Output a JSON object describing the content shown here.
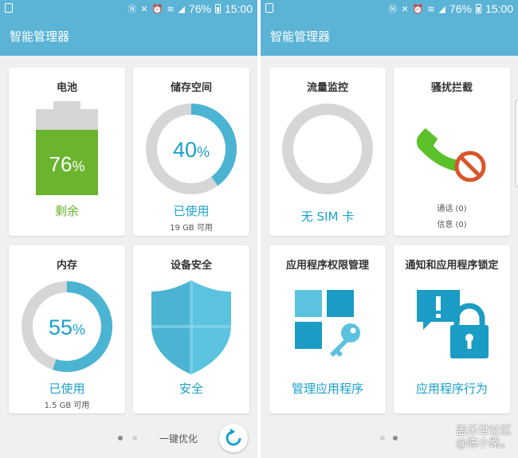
{
  "status": {
    "battery_percent": "76%",
    "time": "15:00",
    "icons": [
      "nfc-icon",
      "mute-icon",
      "alarm-icon",
      "wifi-icon",
      "signal-icon",
      "battery-icon"
    ]
  },
  "left": {
    "title": "智能管理器",
    "battery": {
      "title": "电池",
      "value": "76",
      "unit": "%",
      "label": "剩余",
      "level": 0.76
    },
    "storage": {
      "title": "储存空间",
      "value": "40",
      "unit": "%",
      "label": "已使用",
      "detail": "19 GB 可用",
      "fraction": 0.4
    },
    "memory": {
      "title": "内存",
      "value": "55",
      "unit": "%",
      "label": "已使用",
      "detail": "1.5 GB 可用",
      "fraction": 0.55
    },
    "security": {
      "title": "设备安全",
      "label": "安全"
    },
    "bottom": {
      "optimize_label": "一键优化",
      "page_index": 0,
      "page_count": 2
    }
  },
  "right": {
    "title": "智能管理器",
    "data_monitor": {
      "title": "流量监控",
      "label": "无 SIM 卡"
    },
    "call_block": {
      "title": "骚扰拦截",
      "calls": "通话 (0)",
      "messages": "信息 (0)"
    },
    "app_permissions": {
      "title": "应用程序权限管理",
      "label": "管理应用程序"
    },
    "app_lock": {
      "title": "通知和应用程序锁定",
      "label": "应用程序行为"
    },
    "bottom": {
      "page_index": 1,
      "page_count": 2
    },
    "watermark": {
      "line1": "盖乐世社区",
      "line2": "@陈小路。"
    }
  },
  "colors": {
    "accent": "#5bb3d6",
    "ring": "#4bb4d3",
    "ring_track": "#d6d6d6",
    "battery_green": "#6ab42e",
    "label_blue": "#1aa0cc",
    "phone_green": "#5cc02a",
    "block_orange": "#d9552b"
  }
}
